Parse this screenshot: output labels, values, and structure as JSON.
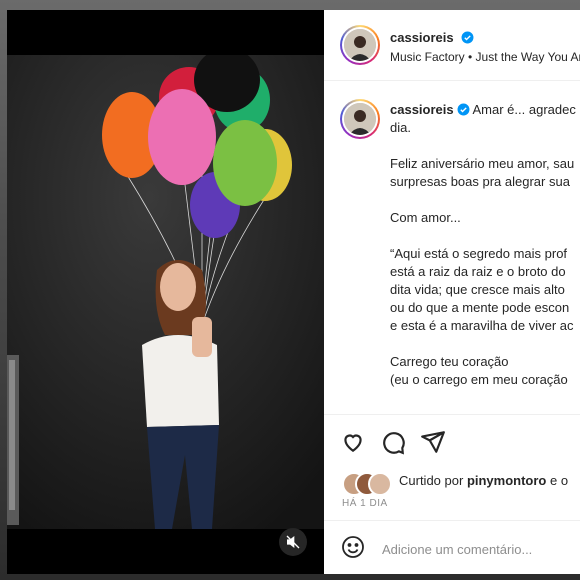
{
  "post": {
    "author": {
      "username": "cassioreis",
      "verified": true,
      "song": "Music Factory • Just the Way You Ar"
    },
    "caption": [
      {
        "text": "Amar é... agradec",
        "with_author": true
      },
      {
        "text": "dia."
      },
      {
        "text": ""
      },
      {
        "text": "Feliz aniversário meu amor, sau"
      },
      {
        "text": "surpresas boas pra alegrar sua"
      },
      {
        "text": ""
      },
      {
        "text": "Com amor..."
      },
      {
        "text": ""
      },
      {
        "text": "“Aqui está o segredo mais prof"
      },
      {
        "text": "está a raiz da raiz e o broto do"
      },
      {
        "text": "dita vida; que cresce mais alto"
      },
      {
        "text": "ou do que a mente pode escon"
      },
      {
        "text": "e esta é a maravilha de viver ac"
      },
      {
        "text": ""
      },
      {
        "text": "Carrego teu coração"
      },
      {
        "text": "(eu o carrego em meu coração"
      }
    ],
    "liked_by_prefix": "Curtido por",
    "liked_by_user": "pinymontoro",
    "liked_by_suffix": " e o",
    "date": "HÁ 1 DIA"
  },
  "comment": {
    "placeholder": "Adicione um comentário..."
  },
  "icons": {
    "like": "heart-icon",
    "comment": "comment-icon",
    "share": "share-icon",
    "emoji": "emoji-icon",
    "mute": "muted-speaker-icon",
    "verified": "verified-badge-icon"
  },
  "colors": {
    "verified": "#0095f6",
    "text": "#262626",
    "muted_text": "#8e8e8e"
  }
}
